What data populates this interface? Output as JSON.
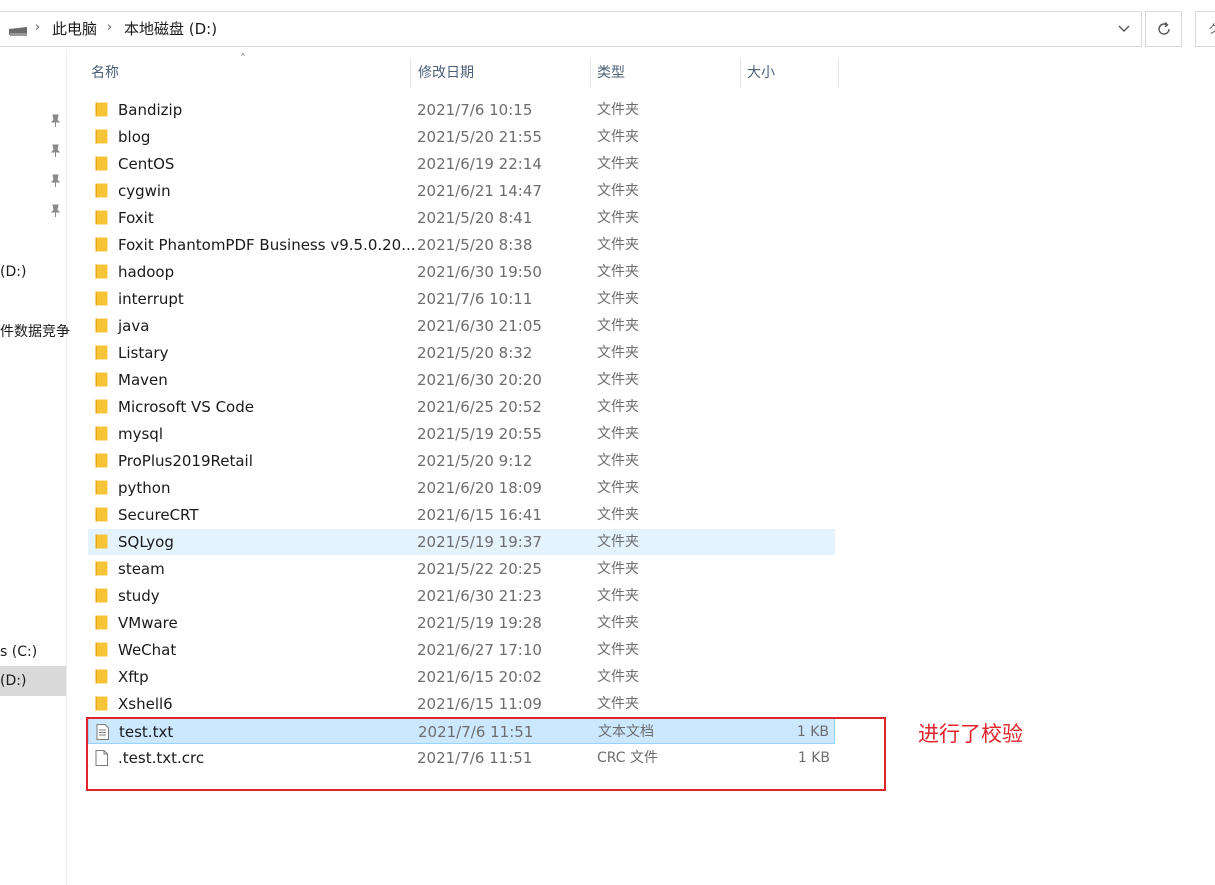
{
  "address_bar": {
    "crumbs": [
      "此电脑",
      "本地磁盘 (D:)"
    ]
  },
  "search": {
    "placeholder": "ク"
  },
  "nav": {
    "items": [
      {
        "label": "(D:)"
      },
      {
        "label": "件数据竞争"
      },
      {
        "label": "s (C:)"
      },
      {
        "label": "(D:)"
      }
    ]
  },
  "columns": {
    "name": "名称",
    "date": "修改日期",
    "type": "类型",
    "size": "大小"
  },
  "files": [
    {
      "name": "Bandizip",
      "date": "2021/7/6 10:15",
      "type": "文件夹",
      "size": "",
      "kind": "folder"
    },
    {
      "name": "blog",
      "date": "2021/5/20 21:55",
      "type": "文件夹",
      "size": "",
      "kind": "folder"
    },
    {
      "name": "CentOS",
      "date": "2021/6/19 22:14",
      "type": "文件夹",
      "size": "",
      "kind": "folder"
    },
    {
      "name": "cygwin",
      "date": "2021/6/21 14:47",
      "type": "文件夹",
      "size": "",
      "kind": "folder"
    },
    {
      "name": "Foxit",
      "date": "2021/5/20 8:41",
      "type": "文件夹",
      "size": "",
      "kind": "folder"
    },
    {
      "name": "Foxit PhantomPDF Business v9.5.0.20...",
      "date": "2021/5/20 8:38",
      "type": "文件夹",
      "size": "",
      "kind": "folder"
    },
    {
      "name": "hadoop",
      "date": "2021/6/30 19:50",
      "type": "文件夹",
      "size": "",
      "kind": "folder"
    },
    {
      "name": "interrupt",
      "date": "2021/7/6 10:11",
      "type": "文件夹",
      "size": "",
      "kind": "folder"
    },
    {
      "name": "java",
      "date": "2021/6/30 21:05",
      "type": "文件夹",
      "size": "",
      "kind": "folder"
    },
    {
      "name": "Listary",
      "date": "2021/5/20 8:32",
      "type": "文件夹",
      "size": "",
      "kind": "folder"
    },
    {
      "name": "Maven",
      "date": "2021/6/30 20:20",
      "type": "文件夹",
      "size": "",
      "kind": "folder"
    },
    {
      "name": "Microsoft VS Code",
      "date": "2021/6/25 20:52",
      "type": "文件夹",
      "size": "",
      "kind": "folder"
    },
    {
      "name": "mysql",
      "date": "2021/5/19 20:55",
      "type": "文件夹",
      "size": "",
      "kind": "folder"
    },
    {
      "name": "ProPlus2019Retail",
      "date": "2021/5/20 9:12",
      "type": "文件夹",
      "size": "",
      "kind": "folder"
    },
    {
      "name": "python",
      "date": "2021/6/20 18:09",
      "type": "文件夹",
      "size": "",
      "kind": "folder"
    },
    {
      "name": "SecureCRT",
      "date": "2021/6/15 16:41",
      "type": "文件夹",
      "size": "",
      "kind": "folder"
    },
    {
      "name": "SQLyog",
      "date": "2021/5/19 19:37",
      "type": "文件夹",
      "size": "",
      "kind": "folder",
      "state": "hover"
    },
    {
      "name": "steam",
      "date": "2021/5/22 20:25",
      "type": "文件夹",
      "size": "",
      "kind": "folder"
    },
    {
      "name": "study",
      "date": "2021/6/30 21:23",
      "type": "文件夹",
      "size": "",
      "kind": "folder"
    },
    {
      "name": "VMware",
      "date": "2021/5/19 19:28",
      "type": "文件夹",
      "size": "",
      "kind": "folder"
    },
    {
      "name": "WeChat",
      "date": "2021/6/27 17:10",
      "type": "文件夹",
      "size": "",
      "kind": "folder"
    },
    {
      "name": "Xftp",
      "date": "2021/6/15 20:02",
      "type": "文件夹",
      "size": "",
      "kind": "folder"
    },
    {
      "name": "Xshell6",
      "date": "2021/6/15 11:09",
      "type": "文件夹",
      "size": "",
      "kind": "folder"
    },
    {
      "name": "test.txt",
      "date": "2021/7/6 11:51",
      "type": "文本文档",
      "size": "1 KB",
      "kind": "text",
      "state": "selected"
    },
    {
      "name": ".test.txt.crc",
      "date": "2021/7/6 11:51",
      "type": "CRC 文件",
      "size": "1 KB",
      "kind": "file"
    }
  ],
  "annotation": {
    "text": "进行了校验",
    "color": "#e0242b"
  },
  "colors": {
    "folder": "#f8c437",
    "selection": "#cce8ff",
    "hover": "#e5f3ff"
  }
}
